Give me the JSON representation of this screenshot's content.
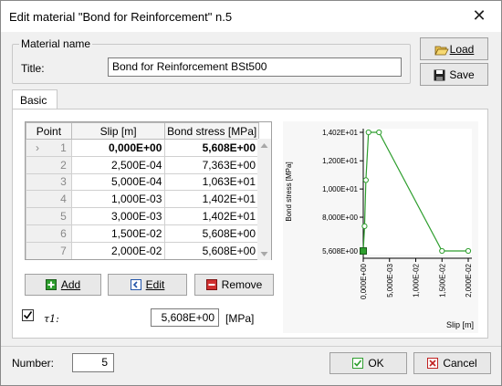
{
  "window": {
    "title": "Edit material  \"Bond for Reinforcement\" n.5",
    "close_glyph": "✕"
  },
  "material": {
    "group_label": "Material name",
    "title_label": "Title:",
    "title_value": "Bond for Reinforcement BSt500"
  },
  "buttons": {
    "load": "Load",
    "save": "Save",
    "add": "Add",
    "edit": "Edit",
    "remove": "Remove",
    "ok": "OK",
    "cancel": "Cancel"
  },
  "tabs": [
    {
      "label": "Basic"
    }
  ],
  "table": {
    "headers": [
      "Point",
      "Slip [m]",
      "Bond stress [MPa]"
    ],
    "rows": [
      {
        "point": "1",
        "slip": "0,000E+00",
        "stress": "5,608E+00"
      },
      {
        "point": "2",
        "slip": "2,500E-04",
        "stress": "7,363E+00"
      },
      {
        "point": "3",
        "slip": "5,000E-04",
        "stress": "1,063E+01"
      },
      {
        "point": "4",
        "slip": "1,000E-03",
        "stress": "1,402E+01"
      },
      {
        "point": "5",
        "slip": "3,000E-03",
        "stress": "1,402E+01"
      },
      {
        "point": "6",
        "slip": "1,500E-02",
        "stress": "5,608E+00"
      },
      {
        "point": "7",
        "slip": "2,000E-02",
        "stress": "5,608E+00"
      }
    ]
  },
  "tau": {
    "label": "τ1:",
    "value": "5,608E+00",
    "unit": "[MPa]",
    "checked": true
  },
  "number": {
    "label": "Number:",
    "value": "5"
  },
  "chart_data": {
    "type": "line",
    "xlabel": "Slip [m]",
    "ylabel": "Bond stress [MPa]",
    "x": [
      0,
      0.00025,
      0.0005,
      0.001,
      0.003,
      0.015,
      0.02
    ],
    "y": [
      5.608,
      7.363,
      10.63,
      14.02,
      14.02,
      5.608,
      5.608
    ],
    "xlim": [
      0,
      0.02
    ],
    "ylim": [
      5.608,
      14.02
    ],
    "xticks": [
      "0,000E+00",
      "5,000E-03",
      "1,000E-02",
      "1,500E-02",
      "2,000E-02"
    ],
    "yticks": [
      "1,402E+01",
      "1,200E+01",
      "1,000E+01",
      "8,000E+00",
      "5,608E+00"
    ],
    "color": "#2e9e2e"
  }
}
